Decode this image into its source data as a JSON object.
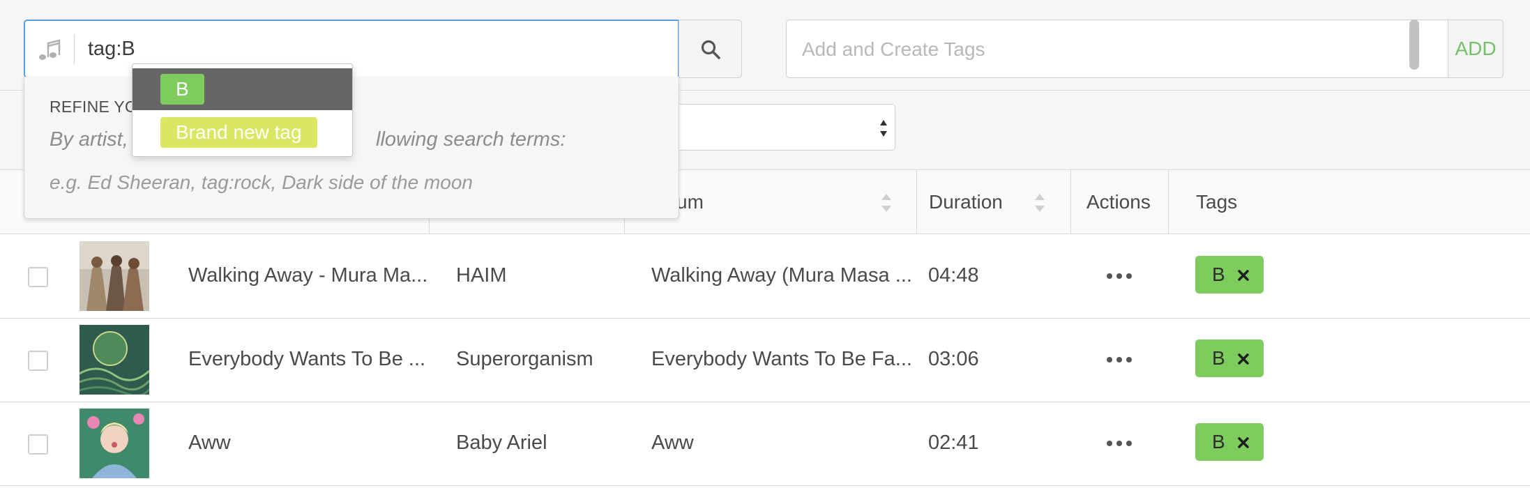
{
  "search": {
    "query": "tag:B",
    "icon": "music-note-icon",
    "button_icon": "search-icon"
  },
  "tags_input": {
    "placeholder": "Add and Create Tags",
    "add_label": "ADD"
  },
  "refine": {
    "title_visible": "REFINE YOU",
    "description_visible_left": "By artist, t",
    "description_visible_right": "llowing search terms:",
    "example": "e.g. Ed Sheeran, tag:rock, Dark side of the moon"
  },
  "autocomplete": {
    "items": [
      {
        "label": "B",
        "style": "existing",
        "color": "#7ecb5e",
        "selected": true
      },
      {
        "label": "Brand new tag",
        "style": "new",
        "color": "#dbe662",
        "selected": false
      }
    ]
  },
  "table": {
    "columns": {
      "album_visible": "um",
      "duration": "Duration",
      "actions": "Actions",
      "tags": "Tags"
    },
    "rows": [
      {
        "title": "Walking Away - Mura Ma...",
        "artist": "HAIM",
        "album": "Walking Away (Mura Masa ...",
        "duration": "04:48",
        "tag": "B"
      },
      {
        "title": "Everybody Wants To Be ...",
        "artist": "Superorganism",
        "album": "Everybody Wants To Be Fa...",
        "duration": "03:06",
        "tag": "B"
      },
      {
        "title": "Aww",
        "artist": "Baby Ariel",
        "album": "Aww",
        "duration": "02:41",
        "tag": "B"
      }
    ]
  },
  "colors": {
    "accent_blue": "#5a9ee0",
    "tag_green": "#7ecb5e",
    "new_tag_yellow": "#dbe662",
    "add_green": "#76bf6a"
  }
}
